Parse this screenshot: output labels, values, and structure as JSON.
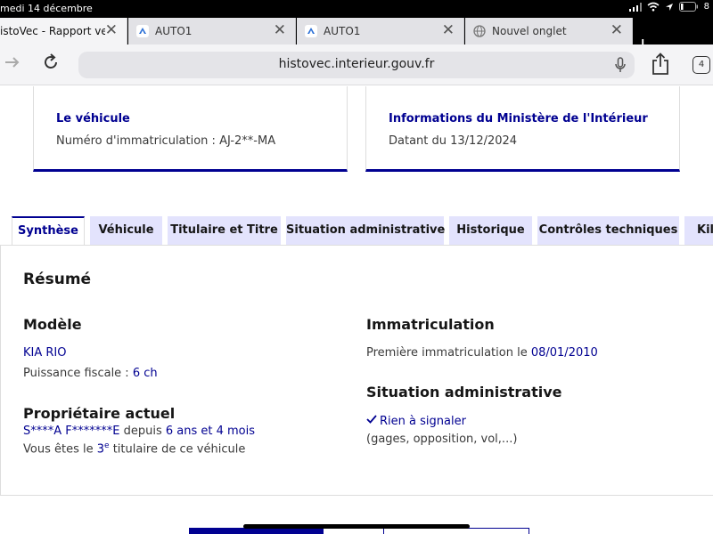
{
  "status_bar": {
    "date": "medi 14 décembre",
    "battery": "8"
  },
  "browser_tabs": [
    {
      "title": "istoVec - Rapport vend",
      "close": "✕"
    },
    {
      "title": "AUTO1",
      "close": "✕"
    },
    {
      "title": "AUTO1",
      "close": "✕"
    },
    {
      "title": "Nouvel onglet",
      "close": "✕"
    }
  ],
  "toolbar": {
    "url": "histovec.interieur.gouv.fr",
    "tab_count": "4",
    "new_tab": "+"
  },
  "cards": [
    {
      "title": "Le véhicule",
      "text": "Numéro d'immatriculation : AJ-2**-MA"
    },
    {
      "title": "Informations du Ministère de l'Intérieur",
      "text": "Datant du 13/12/2024"
    }
  ],
  "page_tabs": [
    "Synthèse",
    "Véhicule",
    "Titulaire et Titre",
    "Situation administrative",
    "Historique",
    "Contrôles techniques",
    "Kilo"
  ],
  "summary": {
    "heading": "Résumé",
    "model": {
      "heading": "Modèle",
      "name": "KIA RIO",
      "power_label": "Puissance fiscale : ",
      "power_value": "6 ch"
    },
    "owner": {
      "heading": "Propriétaire actuel",
      "name": "S****A F*******E",
      "since_label": " depuis ",
      "since_value": "6 ans et 4 mois",
      "rank_prefix": "Vous êtes le ",
      "rank_number": "3",
      "rank_sup": "e",
      "rank_suffix": " titulaire de ce véhicule"
    },
    "registration": {
      "heading": "Immatriculation",
      "label": "Première immatriculation le ",
      "date": "08/01/2010"
    },
    "admin": {
      "heading": "Situation administrative",
      "status": "Rien à signaler",
      "detail": "(gages, opposition, vol,...)"
    }
  },
  "colors": {
    "brand": "#000091",
    "tab_bg": "#e3e3fd"
  }
}
